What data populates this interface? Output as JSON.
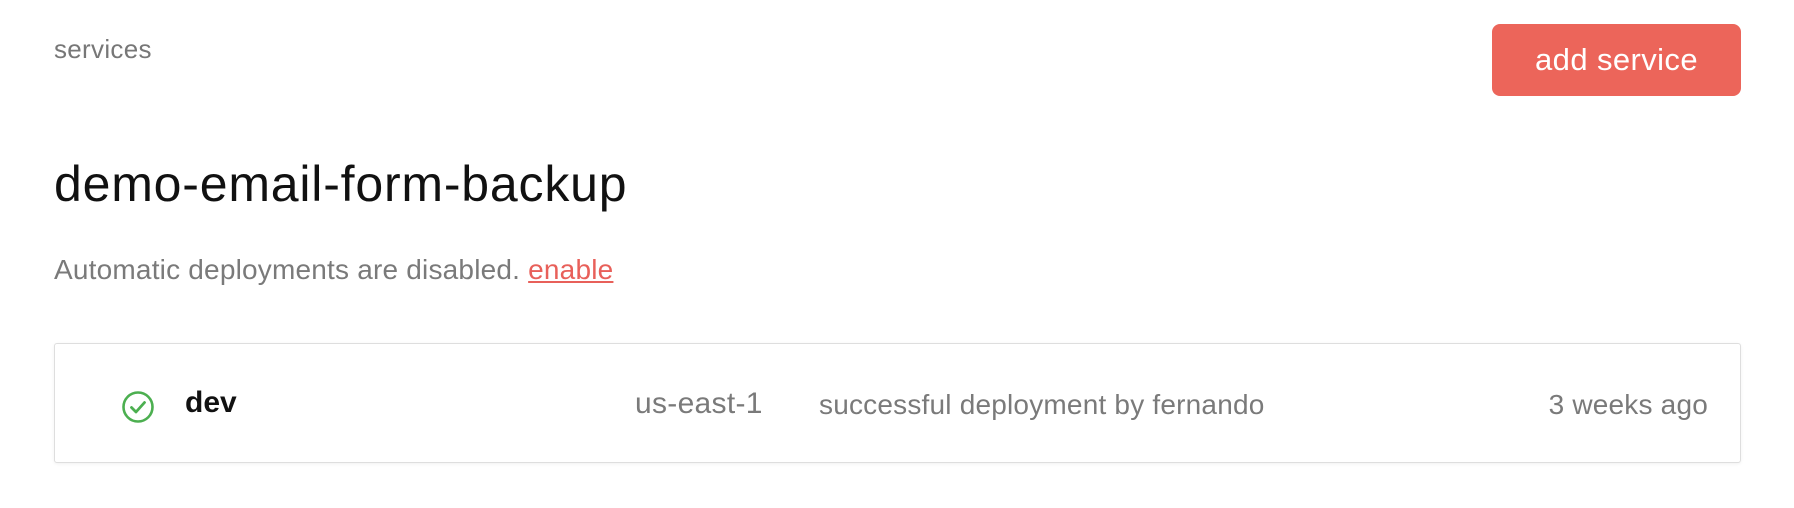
{
  "header": {
    "breadcrumb": "services",
    "add_service_label": "add service"
  },
  "service": {
    "name": "demo-email-form-backup",
    "auto_deploy_note": "Automatic deployments are disabled.",
    "enable_link": "enable"
  },
  "stages": [
    {
      "name": "dev",
      "status_icon": "check-circle-icon",
      "status_color": "#4caf50",
      "region": "us-east-1",
      "message": "successful deployment by fernando",
      "time": "3 weeks ago"
    }
  ],
  "colors": {
    "accent": "#ec655a",
    "link": "#e8605a",
    "success": "#4caf50",
    "muted_text": "#7a7a7a"
  }
}
